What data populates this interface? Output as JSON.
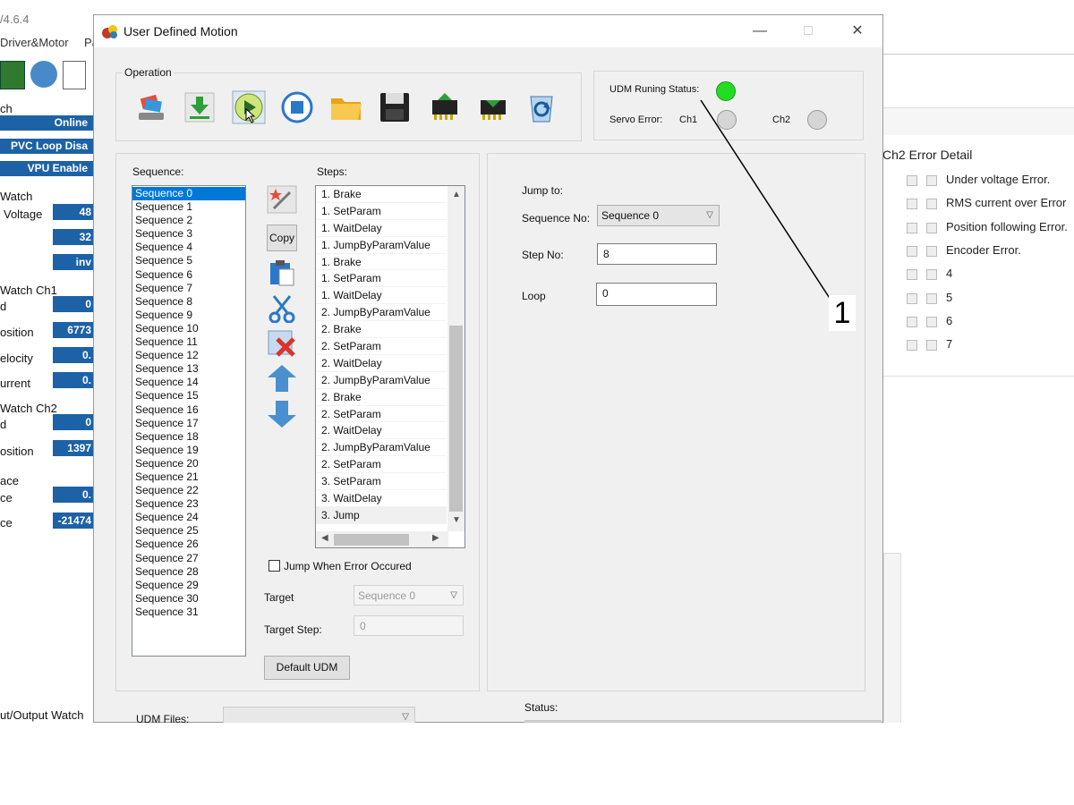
{
  "background": {
    "version": "/4.6.4",
    "menu": [
      "Driver&Motor",
      "Pa"
    ],
    "watch_label": "ch",
    "bars": [
      "Online",
      "PVC Loop Disa",
      "VPU Enable"
    ],
    "voltage_section": "Watch",
    "voltage_label": "Voltage",
    "voltage_values": [
      "48",
      "32",
      "inv"
    ],
    "ch1_section": "Watch Ch1",
    "ch1_rows": [
      {
        "label": "d",
        "value": "0"
      },
      {
        "label": "osition",
        "value": "6773"
      },
      {
        "label": "elocity",
        "value": "0."
      },
      {
        "label": "urrent",
        "value": "0."
      }
    ],
    "ch2_section": "Watch Ch2",
    "ch2_rows": [
      {
        "label": "d",
        "value": "0"
      },
      {
        "label": "osition",
        "value": "1397"
      }
    ],
    "face_section": "ace",
    "face_rows": [
      {
        "label": "ce",
        "value": "0."
      },
      {
        "label": "ce",
        "value": "-21474"
      }
    ],
    "io_watch": "ut/Output Watch",
    "ch2_error_title": "Ch2 Error Detail",
    "errors": [
      "Under voltage Error.",
      "RMS current over Error",
      "Position following Error.",
      "Encoder Error.",
      "4",
      "5",
      "6",
      "7"
    ]
  },
  "dialog": {
    "title": "User Defined Motion",
    "window_controls": {
      "minimize": "—",
      "maximize": "□",
      "close": "✕"
    },
    "operation_label": "Operation",
    "toolbar_icons": [
      "setup-icon",
      "download-icon",
      "play-icon",
      "stop-icon",
      "open-folder-icon",
      "save-icon",
      "chip-read-icon",
      "chip-write-icon",
      "refresh-icon"
    ],
    "status": {
      "running_label": "UDM Runing Status:",
      "running_color": "#22dd22",
      "servo_label": "Servo Error:",
      "ch1_label": "Ch1",
      "ch2_label": "Ch2"
    },
    "sequence_label": "Sequence:",
    "sequences": [
      "Sequence  0",
      "Sequence  1",
      "Sequence  2",
      "Sequence  3",
      "Sequence  4",
      "Sequence  5",
      "Sequence  6",
      "Sequence  7",
      "Sequence  8",
      "Sequence  9",
      "Sequence 10",
      "Sequence 11",
      "Sequence 12",
      "Sequence 13",
      "Sequence 14",
      "Sequence 15",
      "Sequence 16",
      "Sequence 17",
      "Sequence 18",
      "Sequence 19",
      "Sequence 20",
      "Sequence 21",
      "Sequence 22",
      "Sequence 23",
      "Sequence 24",
      "Sequence 25",
      "Sequence 26",
      "Sequence 27",
      "Sequence 28",
      "Sequence 29",
      "Sequence 30",
      "Sequence 31"
    ],
    "steps_label": "Steps:",
    "steps": [
      "1.  Brake",
      "1.  SetParam",
      "1.  WaitDelay",
      "1.  JumpByParamValue",
      "1.  Brake",
      "1.  SetParam",
      "1.  WaitDelay",
      "2.  JumpByParamValue",
      "2.  Brake",
      "2.  SetParam",
      "2.  WaitDelay",
      "2.  JumpByParamValue",
      "2.  Brake",
      "2.  SetParam",
      "2.  WaitDelay",
      "2.  JumpByParamValue",
      "2.  SetParam",
      "3.  SetParam",
      "3.  WaitDelay",
      "3.  Jump"
    ],
    "copy_label": "Copy",
    "jump_when_error": "Jump When Error Occured",
    "target_label": "Target",
    "target_value": "Sequence  0",
    "target_step_label": "Target Step:",
    "target_step_value": "0",
    "default_udm": "Default UDM",
    "jump_to_label": "Jump to:",
    "sequence_no_label": "Sequence No:",
    "sequence_no_value": "Sequence  0",
    "step_no_label": "Step No:",
    "step_no_value": "8",
    "loop_label": "Loop",
    "loop_value": "0",
    "udm_files_label": "UDM Files:",
    "status_label": "Status:"
  },
  "annotation": {
    "number": "1"
  }
}
